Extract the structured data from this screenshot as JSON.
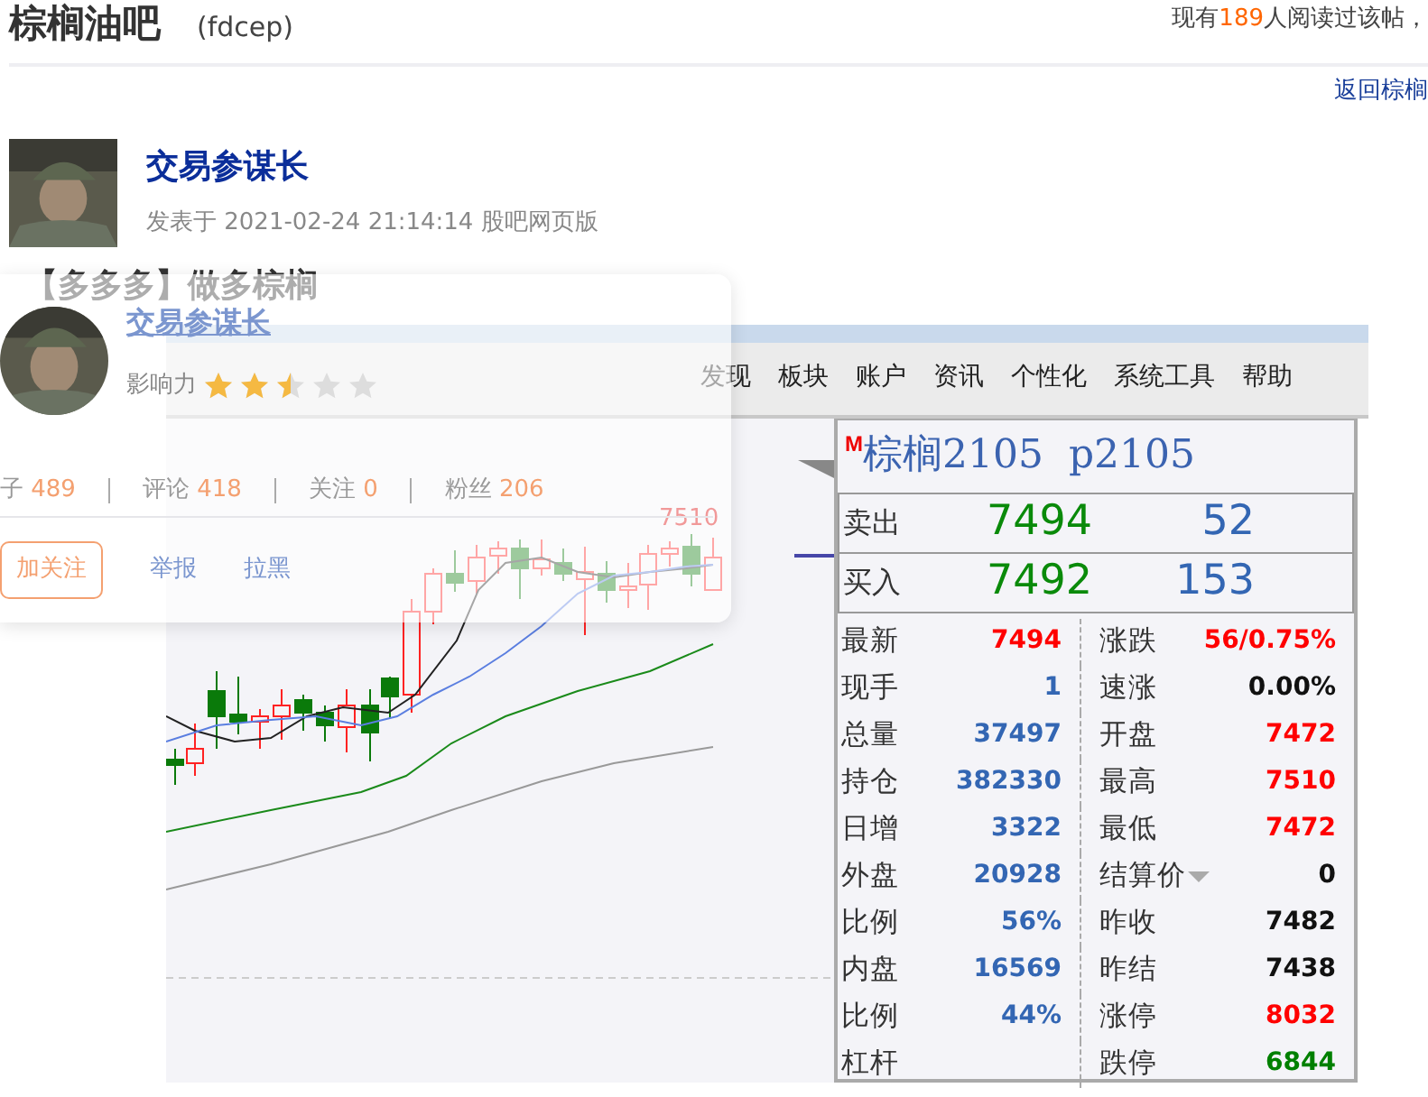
{
  "forum": {
    "name": "棕榈油吧",
    "code": "(fdcep)",
    "readers_prefix": "现有",
    "readers_count": "189",
    "readers_suffix": "人阅读过该帖，",
    "back_link": "返回棕榈"
  },
  "post": {
    "author": "交易参谋长",
    "meta": "发表于 2021-02-24 21:14:14 股吧网页版",
    "title": "【多多多】做多棕榈"
  },
  "screenshot": {
    "menu": [
      "发现",
      "板块",
      "账户",
      "资讯",
      "个性化",
      "系统工具",
      "帮助"
    ],
    "chart_high_label": "7510",
    "quote": {
      "badge": "M",
      "name": "棕榈2105  p2105",
      "sell": {
        "label": "卖出",
        "price": "7494",
        "volume": "52"
      },
      "buy": {
        "label": "买入",
        "price": "7492",
        "volume": "153"
      },
      "rows": [
        {
          "left": {
            "label": "最新",
            "value": "7494",
            "color": "#ff0000"
          },
          "right": {
            "label": "涨跌",
            "value": "56/0.75%",
            "color": "#ff0000"
          }
        },
        {
          "left": {
            "label": "现手",
            "value": "1",
            "color": "#3366b3"
          },
          "right": {
            "label": "速涨",
            "value": "0.00%",
            "color": "#111111"
          }
        },
        {
          "left": {
            "label": "总量",
            "value": "37497",
            "color": "#3366b3"
          },
          "right": {
            "label": "开盘",
            "value": "7472",
            "color": "#ff0000"
          }
        },
        {
          "left": {
            "label": "持仓",
            "value": "382330",
            "color": "#3366b3"
          },
          "right": {
            "label": "最高",
            "value": "7510",
            "color": "#ff0000"
          }
        },
        {
          "left": {
            "label": "日增",
            "value": "3322",
            "color": "#3366b3"
          },
          "right": {
            "label": "最低",
            "value": "7472",
            "color": "#ff0000"
          }
        },
        {
          "left": {
            "label": "外盘",
            "value": "20928",
            "color": "#3366b3"
          },
          "right": {
            "label": "结算价",
            "value": "0",
            "color": "#111111",
            "dropdown": true
          }
        },
        {
          "left": {
            "label": "比例",
            "value": "56%",
            "color": "#3366b3"
          },
          "right": {
            "label": "昨收",
            "value": "7482",
            "color": "#111111"
          }
        },
        {
          "left": {
            "label": "内盘",
            "value": "16569",
            "color": "#3366b3"
          },
          "right": {
            "label": "昨结",
            "value": "7438",
            "color": "#111111"
          }
        },
        {
          "left": {
            "label": "比例",
            "value": "44%",
            "color": "#3366b3"
          },
          "right": {
            "label": "涨停",
            "value": "8032",
            "color": "#ff0000"
          }
        },
        {
          "left": {
            "label": "杠杆"
          },
          "right": {
            "label": "跌停",
            "value": "6844",
            "color": "#008000"
          }
        }
      ]
    }
  },
  "user_card": {
    "name": "交易参谋长",
    "influence_label": "影响力",
    "stars": 2.5,
    "stats": [
      {
        "label": "子",
        "count": "489"
      },
      {
        "label": "评论",
        "count": "418"
      },
      {
        "label": "关注",
        "count": "0"
      },
      {
        "label": "粉丝",
        "count": "206"
      }
    ],
    "follow_button": "加关注",
    "links": [
      "举报",
      "拉黑"
    ]
  }
}
